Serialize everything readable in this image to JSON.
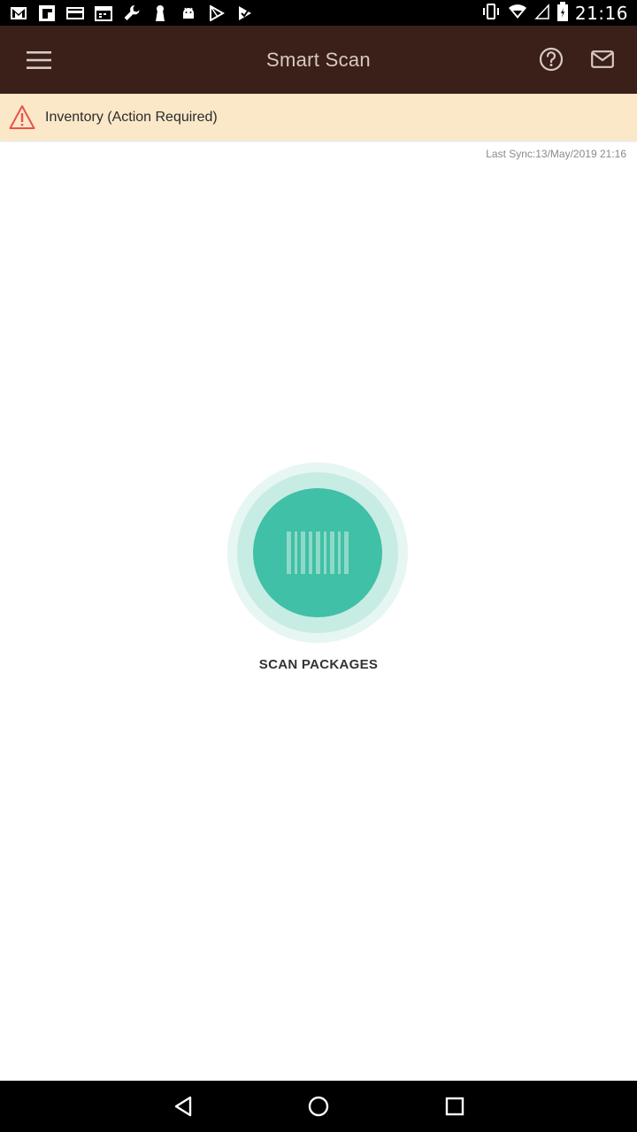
{
  "status_bar": {
    "time": "21:16",
    "left_icons": [
      "gmail-icon",
      "flipboard-icon",
      "card-icon",
      "calendar-icon",
      "wrench-icon",
      "keyhole-icon",
      "android-icon",
      "play-store-icon",
      "play-check-icon"
    ],
    "right_icons": [
      "vibrate-icon",
      "wifi-icon",
      "signal-icon",
      "battery-icon"
    ]
  },
  "app_bar": {
    "title": "Smart Scan",
    "background": "#3b1f19",
    "icons": [
      "menu-icon",
      "help-icon",
      "mail-icon"
    ]
  },
  "alert": {
    "text": "Inventory (Action Required)",
    "background": "#fae8c9",
    "icon": "warning-icon",
    "icon_color": "#e8524a"
  },
  "sync": {
    "text": "Last Sync:13/May/2019 21:16"
  },
  "scan": {
    "label": "SCAN PACKAGES",
    "icon": "barcode-icon",
    "accent": "#40c0a6"
  },
  "nav_bar": {
    "icons": [
      "back-icon",
      "home-icon",
      "recents-icon"
    ]
  }
}
